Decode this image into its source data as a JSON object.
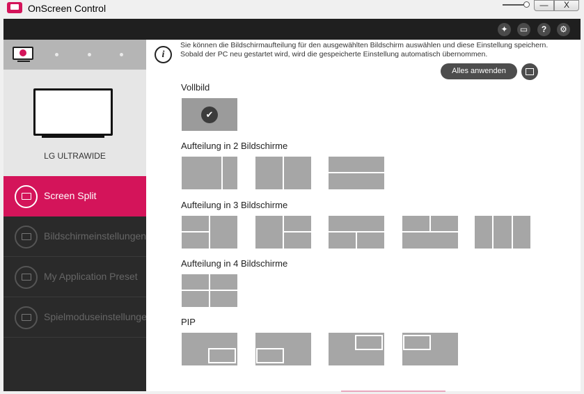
{
  "window": {
    "title": "OnScreen Control",
    "minimize": "—",
    "close": "X"
  },
  "toolbar": {
    "help": "?",
    "settings": "⚙"
  },
  "sidebar": {
    "monitor_name": "LG ULTRAWIDE",
    "items": [
      {
        "label": "Screen Split"
      },
      {
        "label": "Bildschirmeinstellungen"
      },
      {
        "label": "My Application Preset"
      },
      {
        "label": "Spielmoduseinstellungen"
      }
    ]
  },
  "main": {
    "info_text": "Sie können die Bildschirmaufteilung für den ausgewählten Bildschirm auswählen und diese Einstellung speichern. Sobald der PC neu gestartet wird, wird die gespeicherte Einstellung automatisch übernommen.",
    "apply_all_label": "Alles anwenden",
    "sections": {
      "full": "Vollbild",
      "split2": "Aufteilung in 2 Bildschirme",
      "split3": "Aufteilung in 3 Bildschirme",
      "split4": "Aufteilung in 4 Bildschirme",
      "pip": "PIP"
    },
    "check_glyph": "✔"
  },
  "colors": {
    "accent": "#d4145a",
    "panel": "#a6a6a6",
    "sidebar": "#2a2a2a"
  }
}
